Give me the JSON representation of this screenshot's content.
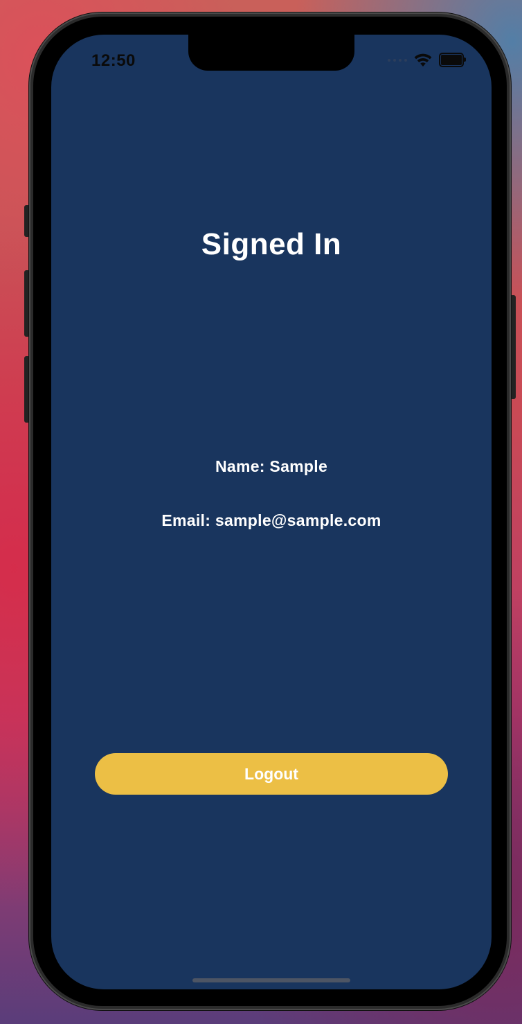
{
  "status_bar": {
    "time": "12:50",
    "icons": [
      "signal-dots-icon",
      "wifi-icon",
      "battery-icon"
    ]
  },
  "screen": {
    "title": "Signed In",
    "name_line": "Name: Sample",
    "email_line": "Email: sample@sample.com",
    "logout_label": "Logout"
  },
  "colors": {
    "background": "#19355e",
    "button": "#ecbf45",
    "text": "#ffffff"
  }
}
